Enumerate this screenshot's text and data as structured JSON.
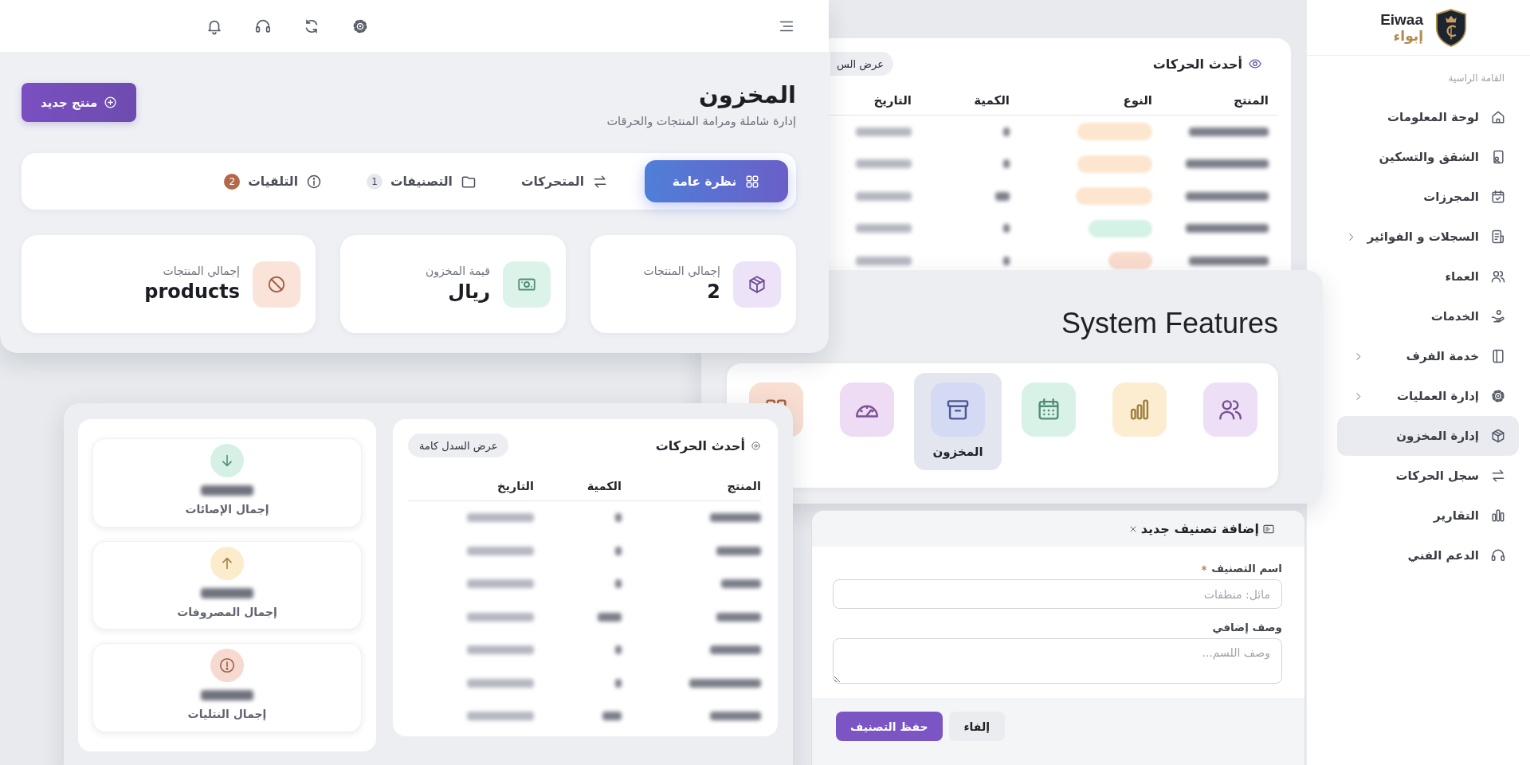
{
  "sidebar": {
    "logo": {
      "latin": "Eiwaa",
      "arabic": "إبواء"
    },
    "section_label": "القامة الراسية",
    "items": [
      {
        "label": "لوحة المعلومات",
        "submenu": false,
        "selected": false
      },
      {
        "label": "الشقق والتسكين",
        "submenu": false,
        "selected": false
      },
      {
        "label": "المجرزات",
        "submenu": false,
        "selected": false
      },
      {
        "label": "السجلات و الفوائير",
        "submenu": true,
        "selected": false
      },
      {
        "label": "العماء",
        "submenu": false,
        "selected": false
      },
      {
        "label": "الخدمات",
        "submenu": false,
        "selected": false
      },
      {
        "label": "خدمة الفرف",
        "submenu": true,
        "selected": false
      },
      {
        "label": "إدارة العمليات",
        "submenu": true,
        "selected": false
      },
      {
        "label": "إدارة المخزون",
        "submenu": false,
        "selected": true
      },
      {
        "label": "سجل الحركات",
        "submenu": false,
        "selected": false
      },
      {
        "label": "التقارير",
        "submenu": false,
        "selected": false
      },
      {
        "label": "الدعم الفني",
        "submenu": false,
        "selected": false
      }
    ]
  },
  "inventory": {
    "title": "المخزون",
    "subtitle": "إدارة شاملة ومرامة المنتجات والحرقات",
    "new_button": "منتج جديد",
    "tabs": [
      {
        "label": "نظرة عامة",
        "selected": true
      },
      {
        "label": "المتحركات",
        "selected": false
      },
      {
        "label": "التصنيفات",
        "selected": false,
        "badge": {
          "text": "1",
          "color": "#e6e8ee"
        }
      },
      {
        "label": "التلقيات",
        "selected": false,
        "badge": {
          "text": "2",
          "color": "#b5674a"
        }
      }
    ],
    "stats": [
      {
        "label": "إجمالي المنتجات",
        "value": "2",
        "color": "#ede3f8"
      },
      {
        "label": "قيمة المخزون",
        "value": "ريال",
        "color": "#dcf3ea"
      },
      {
        "label": "إجمالي المنتجات",
        "value": "products",
        "color": "#fae3d9"
      }
    ]
  },
  "recent_movements_top": {
    "title": "أحدث الحركات",
    "button": "عرض الس",
    "columns": [
      "المنتج",
      "النوع",
      "الكمية",
      "التاريخ"
    ],
    "rows": [
      {
        "color": "#fde6cf"
      },
      {
        "color": "#fde6cf"
      },
      {
        "color": "#fde6cf"
      },
      {
        "color": "#d5f2e6"
      },
      {
        "color": "#f9dccd"
      }
    ]
  },
  "features": {
    "title": "System Features",
    "items": [
      {
        "color": "#ecdff6",
        "selected": false
      },
      {
        "color": "#fcedd0",
        "selected": false
      },
      {
        "color": "#d9f2e8",
        "selected": false
      },
      {
        "label": "المخزون",
        "color": "#d5daf4",
        "selected": true
      },
      {
        "color": "#eddcf4",
        "selected": false
      },
      {
        "color": "#f9dfd2",
        "selected": false
      }
    ]
  },
  "summary": {
    "stats": [
      {
        "label": "إجمال الإصائات",
        "color": "#d6f0e5"
      },
      {
        "label": "إجمال المصروفات",
        "color": "#fdeccb"
      },
      {
        "label": "إجمال النتليات",
        "color": "#f6d9cf"
      }
    ]
  },
  "recent_movements": {
    "title": "أحدث الحركات",
    "button": "عرض السدل كامة",
    "columns": [
      "المنتج",
      "الكمية",
      "التاريخ"
    ]
  },
  "category_form": {
    "title": "إضافة تصنيف جديد",
    "fields": [
      {
        "kind": "input",
        "label": "اسم التصنيف",
        "required": true,
        "placeholder": "مائل: منطفات"
      },
      {
        "kind": "textarea",
        "label": "وصف إضافي",
        "required": false,
        "placeholder": "وصف اللسم..."
      }
    ],
    "buttons": [
      {
        "kind": "secondary",
        "label": "إلفاء"
      },
      {
        "kind": "primary",
        "label": "حفظ التصنيف"
      }
    ]
  }
}
